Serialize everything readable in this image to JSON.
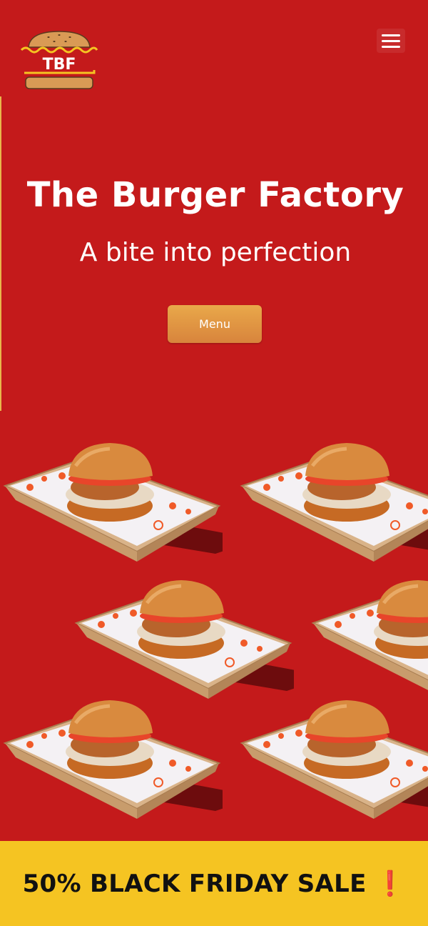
{
  "header": {
    "logo_text": "TBF",
    "menu_icon": "hamburger-menu-icon"
  },
  "hero": {
    "title": "The Burger Factory",
    "subtitle": "A bite into perfection",
    "menu_button_label": "Menu"
  },
  "burgers": {
    "image_name": "chicken-burger-in-tray",
    "count": 6
  },
  "sale_banner": {
    "text": "50% BLACK FRIDAY SALE",
    "mark": "❗"
  },
  "colors": {
    "background_red": "#c41a1b",
    "button_gold": "#e0963f",
    "banner_yellow": "#f5c422",
    "logo_yellow": "#f5c422"
  }
}
